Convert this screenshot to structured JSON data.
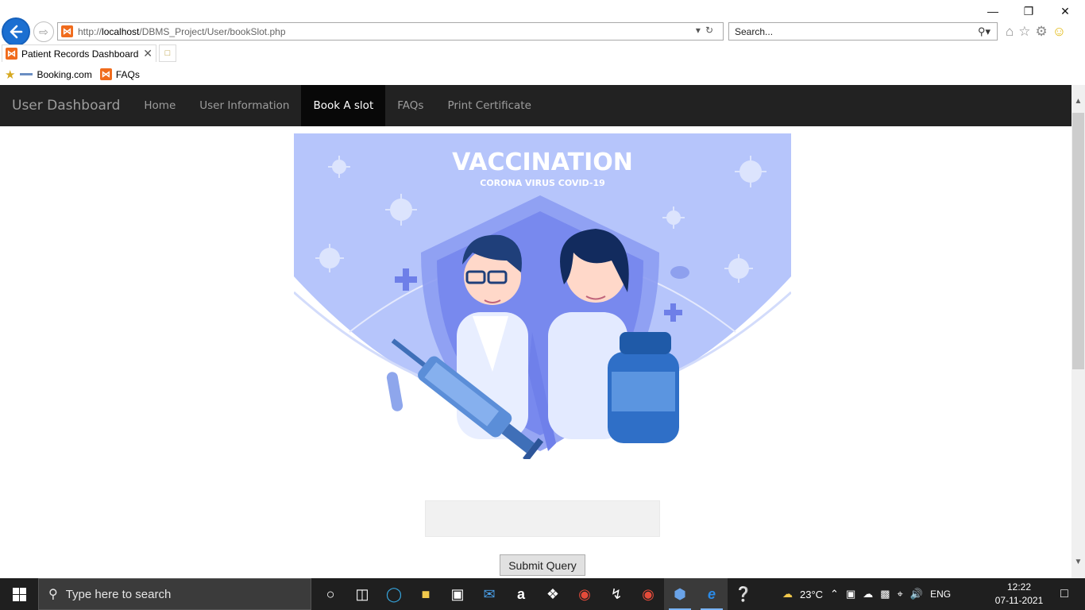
{
  "browser": {
    "url_prefix": "http://",
    "url_host": "localhost",
    "url_path": "/DBMS_Project/User/bookSlot.php",
    "search_placeholder": "Search...",
    "tab_title": "Patient Records Dashboard",
    "favorites": [
      {
        "label": "Booking.com",
        "icon": "booking-icon"
      },
      {
        "label": "FAQs",
        "icon": "xampp-icon"
      }
    ]
  },
  "navbar": {
    "brand": "User Dashboard",
    "items": [
      {
        "label": "Home",
        "active": false
      },
      {
        "label": "User Information",
        "active": false
      },
      {
        "label": "Book A slot",
        "active": true
      },
      {
        "label": "FAQs",
        "active": false
      },
      {
        "label": "Print Certificate",
        "active": false
      }
    ]
  },
  "hero": {
    "title": "VACCINATION",
    "subtitle": "CORONA VIRUS COVID-19",
    "bg_color": "#b6c5fb"
  },
  "form": {
    "slot_value": "",
    "submit_label": "Submit Query"
  },
  "taskbar": {
    "search_placeholder": "Type here to search",
    "weather": "23°C",
    "language": "ENG",
    "time": "12:22",
    "date": "07-11-2021"
  },
  "colors": {
    "navbar_bg": "#222222",
    "navbar_active_bg": "#080808",
    "browser_accent": "#1b6fd1"
  }
}
